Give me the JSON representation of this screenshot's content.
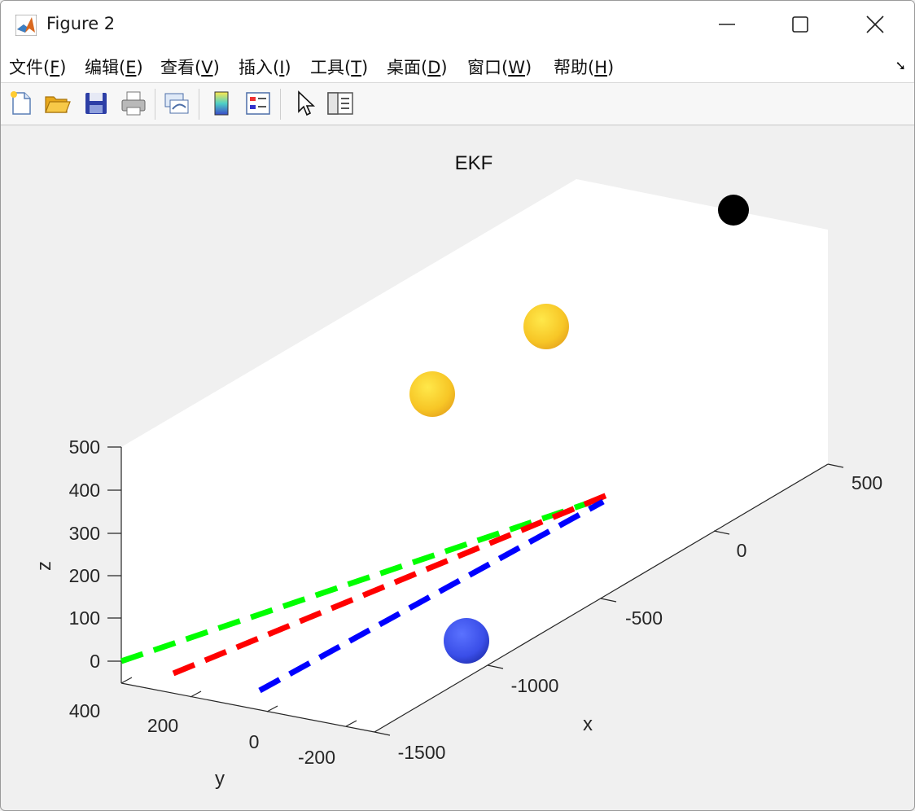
{
  "window": {
    "title": "Figure 2",
    "controls": {
      "minimize": "—",
      "maximize": "☐",
      "close": "✕"
    }
  },
  "menu": {
    "items": [
      {
        "label": "文件(",
        "key": "F",
        "suffix": ")"
      },
      {
        "label": "编辑(",
        "key": "E",
        "suffix": ")"
      },
      {
        "label": "查看(",
        "key": "V",
        "suffix": ")"
      },
      {
        "label": "插入(",
        "key": "I",
        "suffix": ")"
      },
      {
        "label": "工具(",
        "key": "T",
        "suffix": ")"
      },
      {
        "label": "桌面(",
        "key": "D",
        "suffix": ")"
      },
      {
        "label": "窗口(",
        "key": "W",
        "suffix": ")"
      },
      {
        "label": "帮助(",
        "key": "H",
        "suffix": ")"
      }
    ],
    "dock_glyph": "➘"
  },
  "toolbar": {
    "icons": [
      "new-figure-icon",
      "open-file-icon",
      "save-icon",
      "print-icon",
      "link-plot-icon",
      "colorbar-icon",
      "legend-icon",
      "pointer-icon",
      "property-inspector-icon"
    ]
  },
  "chart_data": {
    "type": "3d-scatter-line",
    "title": "EKF",
    "xlabel": "x",
    "ylabel": "y",
    "zlabel": "z",
    "x_ticks": [
      "-1500",
      "-1000",
      "-500",
      "0",
      "500"
    ],
    "y_ticks": [
      "400",
      "200",
      "0",
      "-200"
    ],
    "z_ticks": [
      "500",
      "400",
      "300",
      "200",
      "100",
      "0"
    ],
    "xlim": [
      -1500,
      500
    ],
    "ylim": [
      -300,
      400
    ],
    "zlim": [
      0,
      500
    ],
    "series": [
      {
        "style": "dashed",
        "color": "#00ff00",
        "points": [
          [
            -1500,
            400,
            0
          ],
          [
            500,
            400,
            0
          ]
        ]
      },
      {
        "style": "dashed",
        "color": "#ff0000",
        "points": [
          [
            -1500,
            200,
            0
          ],
          [
            500,
            200,
            0
          ]
        ]
      },
      {
        "style": "dashed",
        "color": "#0000ff",
        "points": [
          [
            -1500,
            0,
            0
          ],
          [
            500,
            0,
            0
          ]
        ]
      }
    ],
    "spheres": [
      {
        "color": "#f5d22a",
        "center": [
          -800,
          300,
          400
        ]
      },
      {
        "color": "#f5d22a",
        "center": [
          -400,
          200,
          480
        ]
      },
      {
        "color": "#3a4ee8",
        "center": [
          -1100,
          -250,
          0
        ]
      },
      {
        "color": "#000000",
        "center": [
          500,
          -100,
          500
        ]
      }
    ]
  }
}
